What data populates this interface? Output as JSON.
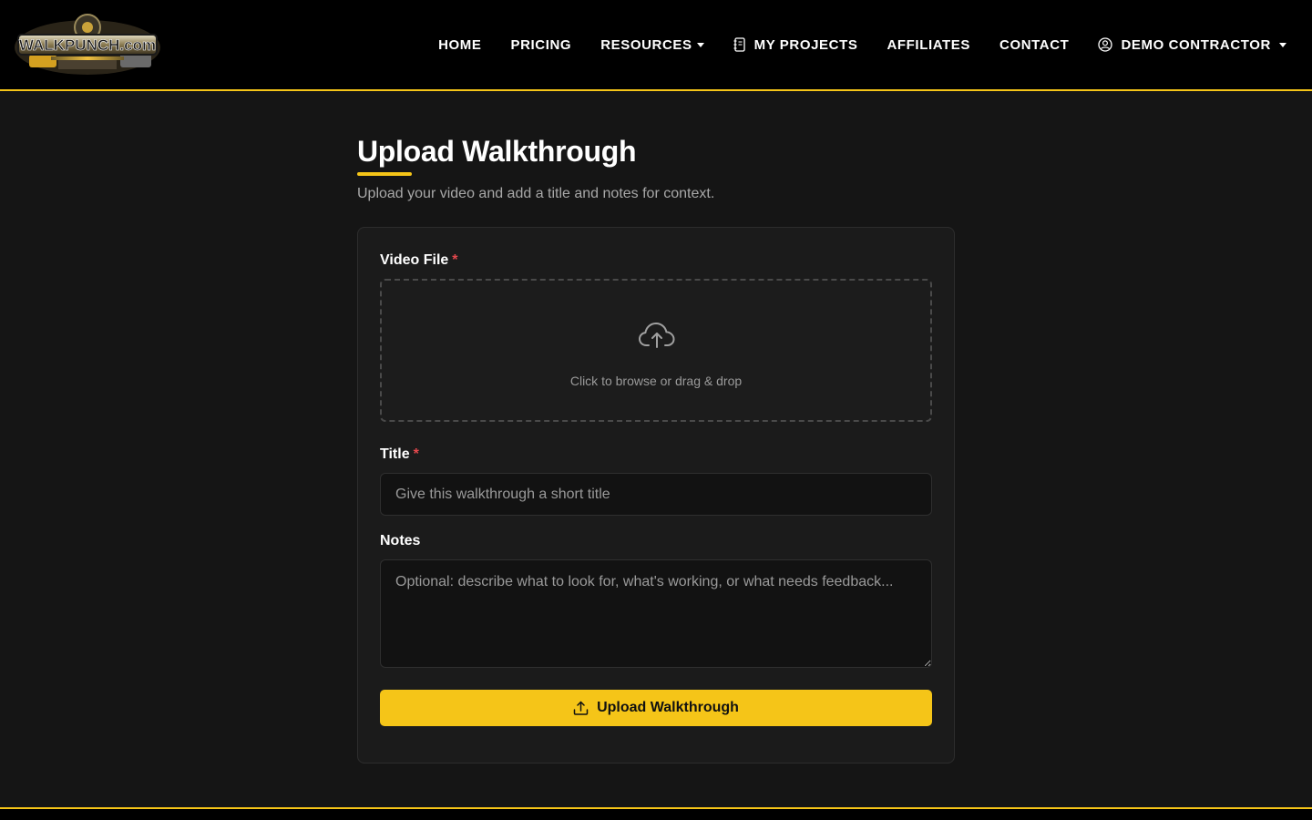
{
  "brand": {
    "logo_text": "WALKPUNCH.com",
    "accent_color": "#f5c518"
  },
  "nav": {
    "items": [
      {
        "label": "HOME"
      },
      {
        "label": "PRICING"
      },
      {
        "label": "RESOURCES",
        "icon": "caret-down-icon"
      },
      {
        "label": "MY PROJECTS",
        "icon": "notebook-icon"
      },
      {
        "label": "AFFILIATES"
      },
      {
        "label": "CONTACT"
      },
      {
        "label": "DEMO CONTRACTOR",
        "icon": "user-circle-icon"
      }
    ]
  },
  "page": {
    "title": "Upload Walkthrough",
    "subtitle": "Upload your video and add a title and notes for context."
  },
  "form": {
    "video_label": "Video File",
    "required_mark": "*",
    "dropzone_text": "Click to browse or drag & drop",
    "dropzone_icon": "cloud-upload-icon",
    "title_label": "Title",
    "title_placeholder": "Give this walkthrough a short title",
    "title_value": "",
    "notes_label": "Notes",
    "notes_placeholder": "Optional: describe what to look for, what's working, or what needs feedback...",
    "notes_value": "",
    "submit_label": "Upload Walkthrough",
    "submit_icon": "upload-icon"
  }
}
